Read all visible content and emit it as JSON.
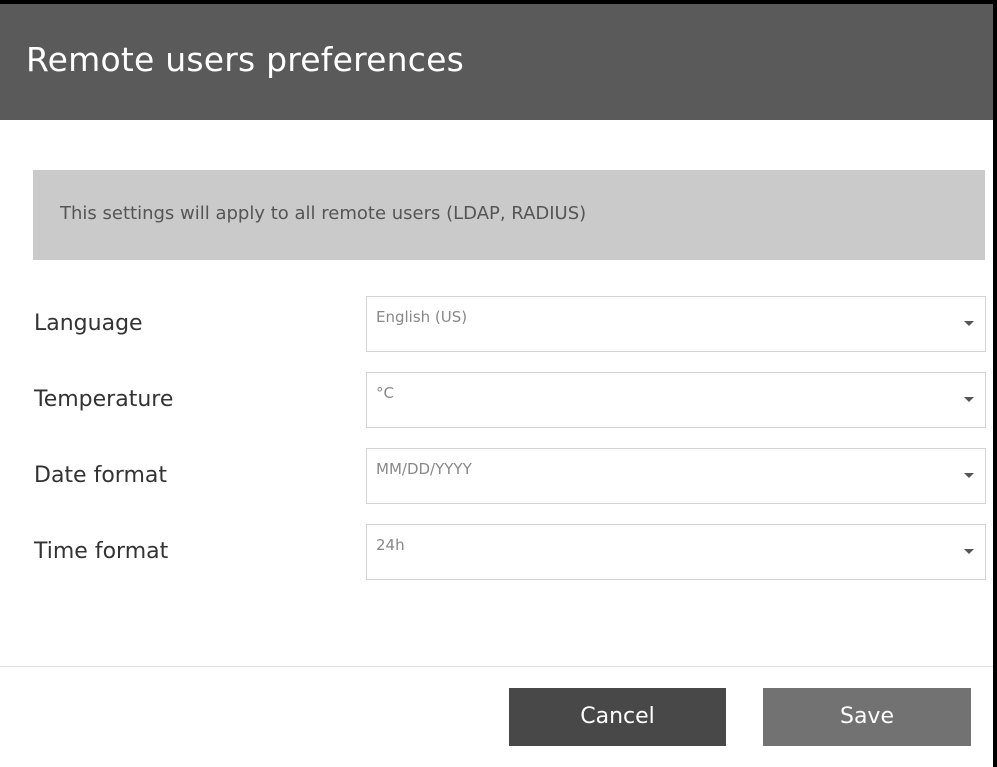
{
  "dialog": {
    "title": "Remote users preferences",
    "notice": "This settings will apply to all remote users (LDAP, RADIUS)"
  },
  "fields": [
    {
      "label": "Language",
      "value": "English (US)",
      "icon": "chevron-down-icon"
    },
    {
      "label": "Temperature",
      "value": "°C",
      "icon": "chevron-down-icon"
    },
    {
      "label": "Date format",
      "value": "MM/DD/YYYY",
      "icon": "chevron-down-icon"
    },
    {
      "label": "Time format",
      "value": "24h",
      "icon": "chevron-down-icon"
    }
  ],
  "footer": {
    "cancel_label": "Cancel",
    "save_label": "Save"
  },
  "colors": {
    "header_bg": "#5a5a5a",
    "notice_bg": "#cacaca",
    "cancel_bg": "#484848",
    "save_bg": "#727272"
  }
}
